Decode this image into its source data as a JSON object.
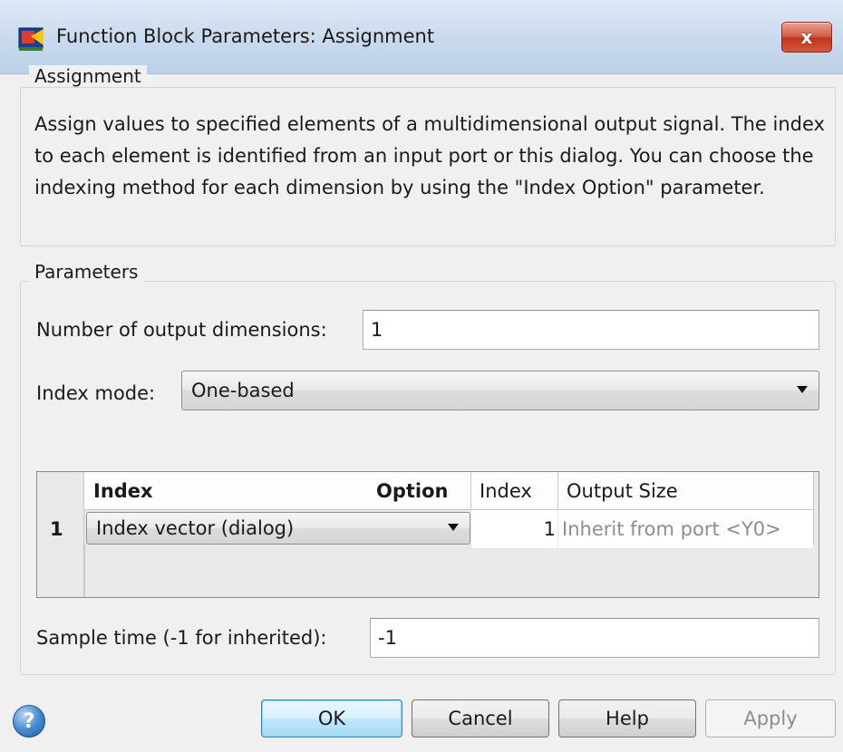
{
  "window": {
    "title": "Function Block Parameters: Assignment",
    "close_label": "x",
    "icon": "simulink-block-icon"
  },
  "description": {
    "legend": "Assignment",
    "text": "Assign values to specified elements of a multidimensional output signal. The index to each element is identified from an input port or this dialog. You can choose the indexing method for each dimension by using the \"Index Option\" parameter."
  },
  "parameters": {
    "legend": "Parameters",
    "num_dims_label": "Number of output dimensions:",
    "num_dims_value": "1",
    "index_mode_label": "Index mode:",
    "index_mode_value": "One-based",
    "table": {
      "headers": {
        "index_option_a": "Index",
        "index_option_b": "Option",
        "index": "Index",
        "output_size": "Output Size"
      },
      "rows": [
        {
          "num": "1",
          "index_option": "Index vector (dialog)",
          "index": "1",
          "output_size": "Inherit from port <Y0>"
        }
      ]
    },
    "sample_time_label": "Sample time (-1 for inherited):",
    "sample_time_value": "-1"
  },
  "buttons": {
    "ok": "OK",
    "cancel": "Cancel",
    "help": "Help",
    "apply": "Apply",
    "help_icon": "?"
  },
  "colors": {
    "titlebar": "#c9daee",
    "close": "#c2361e",
    "default_button": "#bee6fd"
  }
}
